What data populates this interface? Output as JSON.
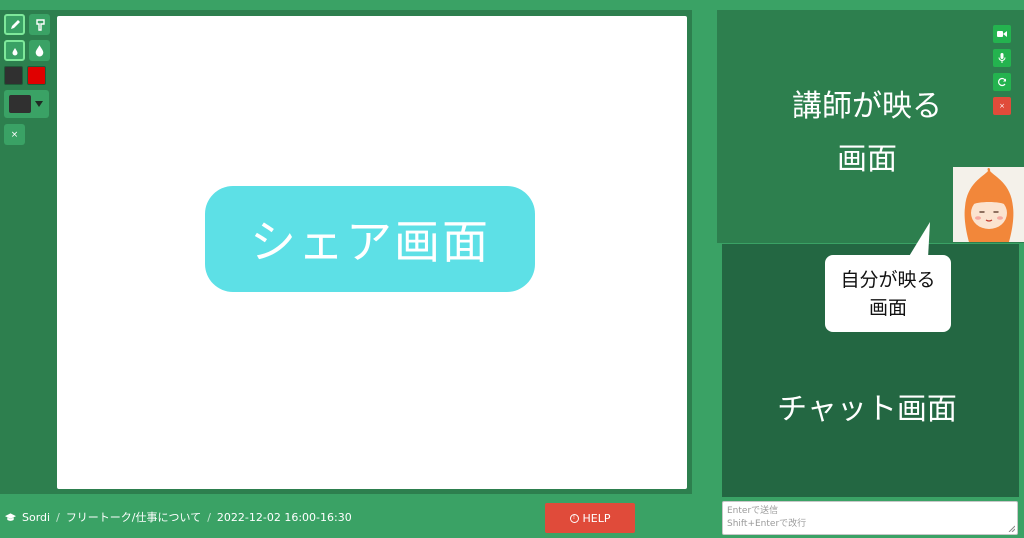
{
  "board": {
    "share_label": "シェア画面",
    "toolbar": {
      "tools": [
        "pen-icon",
        "marker-icon",
        "drop-small-icon",
        "drop-large-icon"
      ],
      "colors": {
        "primary": "#303030",
        "secondary": "#e00000"
      },
      "selected_color": "#303030",
      "clear_label": "×"
    }
  },
  "breadcrumb": {
    "user": "Sordi",
    "topic": "フリートーク/仕事について",
    "schedule": "2022-12-02 16:00-16:30"
  },
  "help": {
    "label": "HELP"
  },
  "video": {
    "teacher_label_line1": "講師が映る",
    "teacher_label_line2": "画面",
    "controls": [
      "video-icon",
      "mic-icon",
      "refresh-icon",
      "close-icon"
    ],
    "close_label": "×"
  },
  "self_view": {
    "line1": "自分が映る",
    "line2": "画面"
  },
  "chat": {
    "label": "チャット画面",
    "placeholder_line1": "Enterで送信",
    "placeholder_line2": "Shift+Enterで改行"
  },
  "colors": {
    "background": "#3aa265",
    "panel": "#2d7f4e",
    "chat_panel": "#236742",
    "share_label_bg": "#5de0e6",
    "help_button": "#e04b3a",
    "control_green": "#24b34f"
  }
}
